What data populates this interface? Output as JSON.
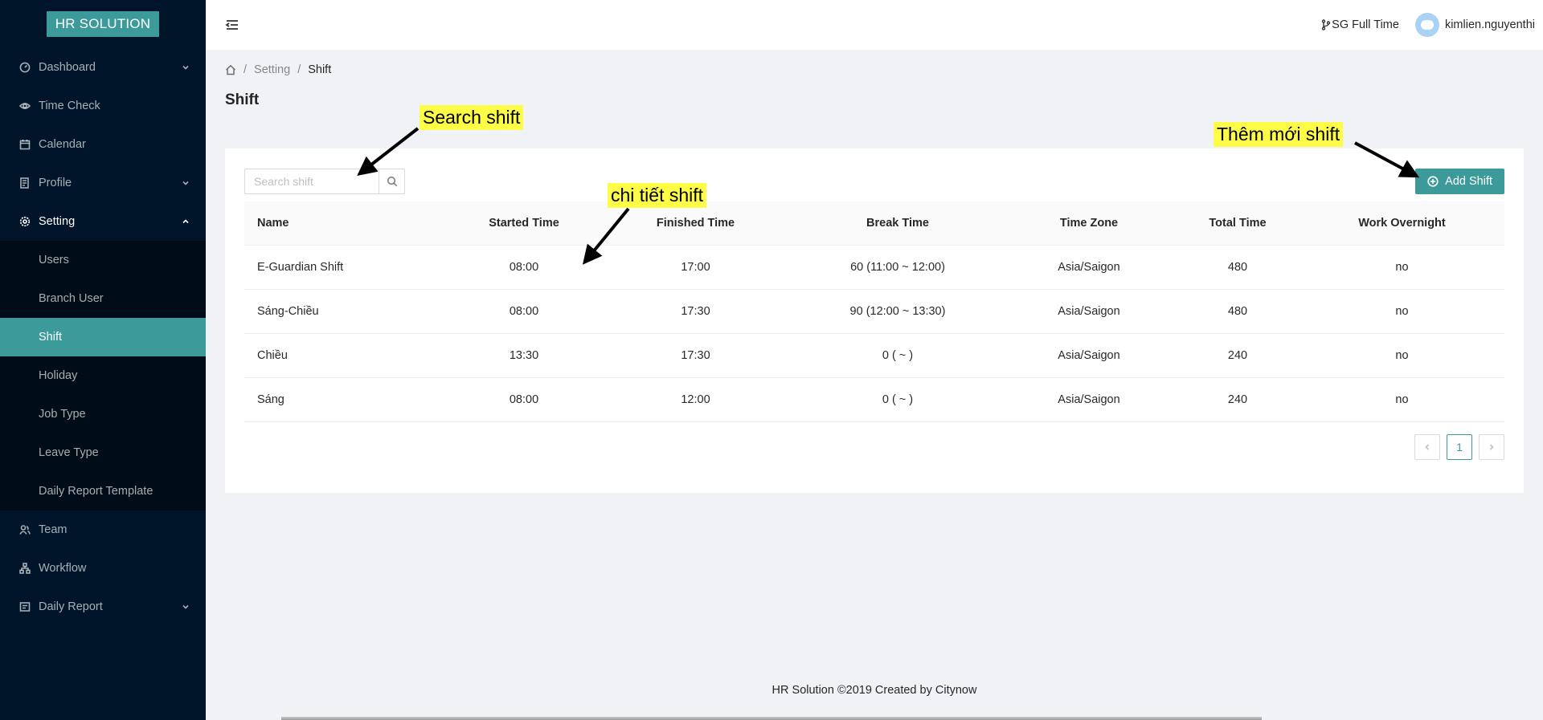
{
  "logo": "HR SOLUTION",
  "sidebar": {
    "items": [
      {
        "label": "Dashboard",
        "icon": "dashboard-icon",
        "expandable": true
      },
      {
        "label": "Time Check",
        "icon": "eye-icon",
        "expandable": false
      },
      {
        "label": "Calendar",
        "icon": "calendar-icon",
        "expandable": false
      },
      {
        "label": "Profile",
        "icon": "profile-icon",
        "expandable": true
      },
      {
        "label": "Setting",
        "icon": "gear-icon",
        "expandable": true,
        "open": true
      },
      {
        "label": "Team",
        "icon": "team-icon",
        "expandable": false
      },
      {
        "label": "Workflow",
        "icon": "workflow-icon",
        "expandable": false
      },
      {
        "label": "Daily Report",
        "icon": "report-icon",
        "expandable": true
      }
    ],
    "setting_sub": [
      "Users",
      "Branch User",
      "Shift",
      "Holiday",
      "Job Type",
      "Leave Type",
      "Daily Report Template"
    ],
    "active_sub": "Shift"
  },
  "header": {
    "branch": "SG Full Time",
    "username": "kimlien.nguyenthi"
  },
  "breadcrumb": {
    "level1": "Setting",
    "level2": "Shift"
  },
  "page_title": "Shift",
  "search": {
    "placeholder": "Search shift",
    "value": ""
  },
  "add_button": "Add Shift",
  "table": {
    "columns": [
      "Name",
      "Started Time",
      "Finished Time",
      "Break Time",
      "Time Zone",
      "Total Time",
      "Work Overnight"
    ],
    "rows": [
      [
        "E-Guardian Shift",
        "08:00",
        "17:00",
        "60 (11:00 ~ 12:00)",
        "Asia/Saigon",
        "480",
        "no"
      ],
      [
        "Sáng-Chiều",
        "08:00",
        "17:30",
        "90 (12:00 ~ 13:30)",
        "Asia/Saigon",
        "480",
        "no"
      ],
      [
        "Chiều",
        "13:30",
        "17:30",
        "0 ( ~ )",
        "Asia/Saigon",
        "240",
        "no"
      ],
      [
        "Sáng",
        "08:00",
        "12:00",
        "0 ( ~ )",
        "Asia/Saigon",
        "240",
        "no"
      ]
    ]
  },
  "pagination": {
    "current": "1"
  },
  "footer": "HR Solution ©2019 Created by Citynow",
  "annotations": {
    "search": "Search shift",
    "detail": "chi tiết shift",
    "add": "Thêm mới shift"
  },
  "colors": {
    "accent": "#3d9a9b",
    "sidebar": "#001529",
    "submenu": "#000c17",
    "highlight": "#fdfc47"
  }
}
